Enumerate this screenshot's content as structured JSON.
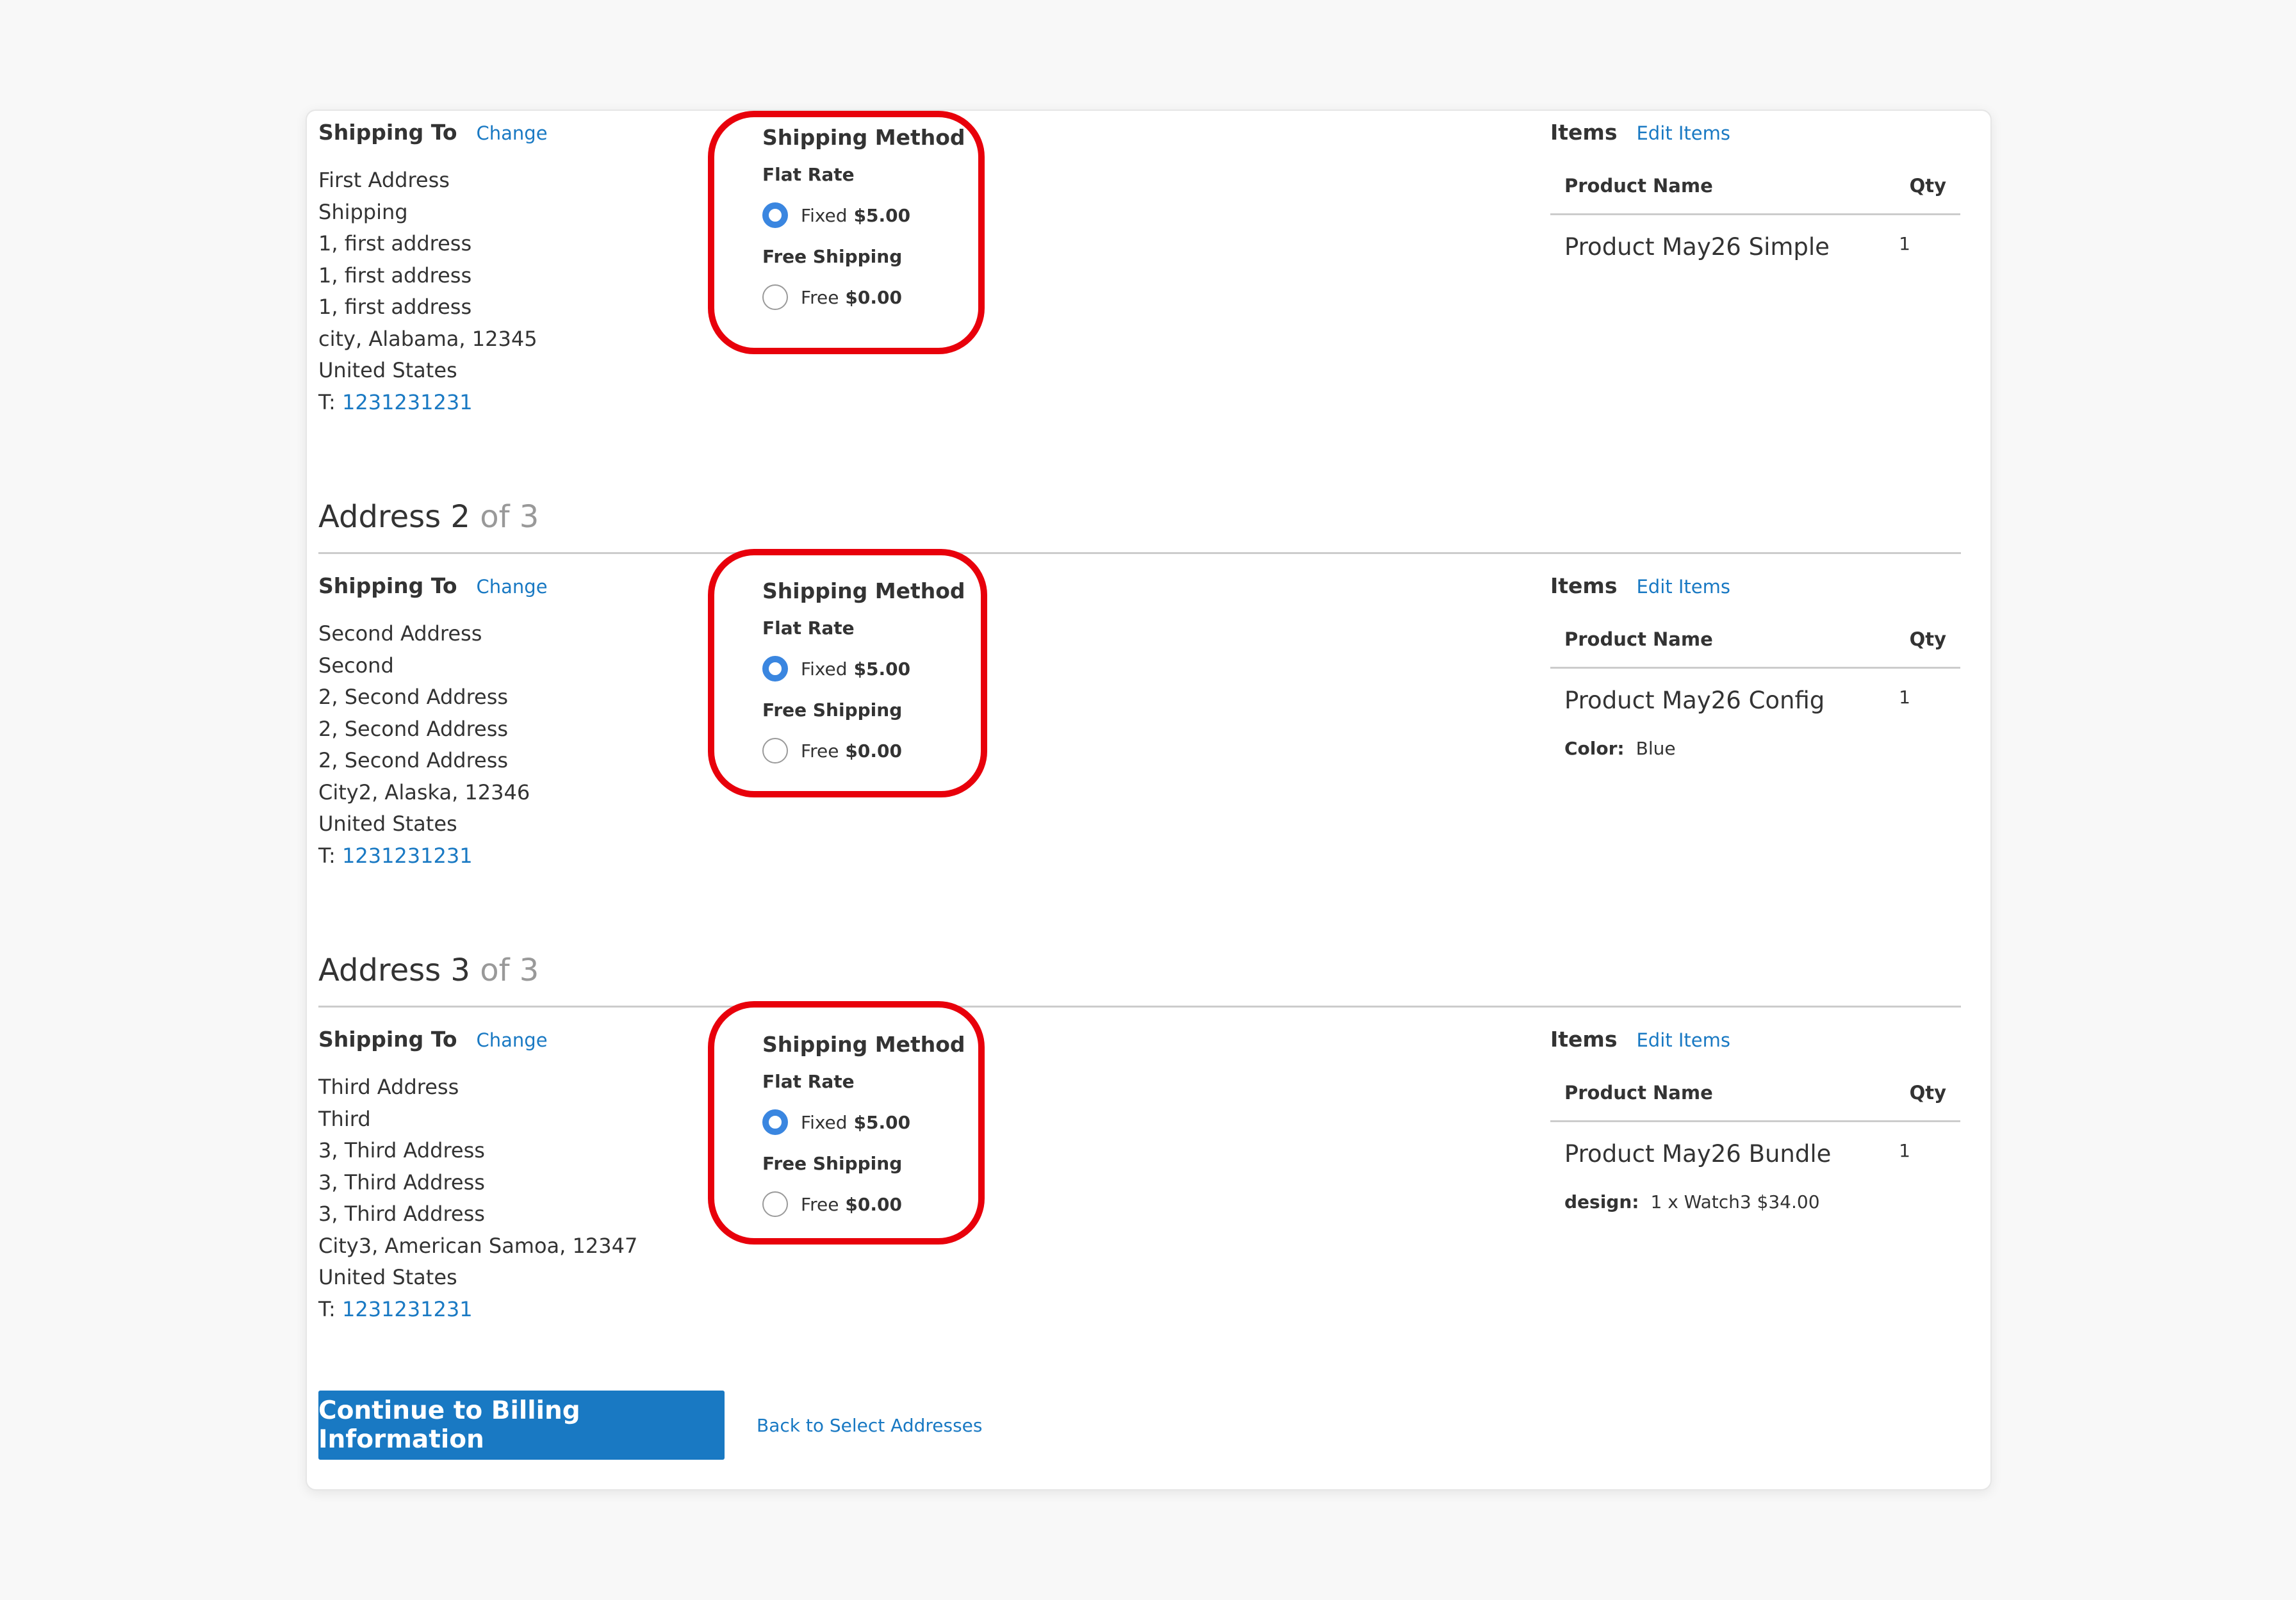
{
  "labels": {
    "shipping_to": "Shipping To",
    "change": "Change",
    "shipping_method": "Shipping Method",
    "items": "Items",
    "edit_items": "Edit Items",
    "product_name": "Product Name",
    "qty": "Qty",
    "address_word": "Address",
    "phone_prefix": "T:"
  },
  "sections": [
    {
      "address_number": "",
      "address_of": "",
      "address_lines": [
        "First Address",
        "Shipping",
        "1, first address",
        "1, first address",
        "1, first address",
        "city, Alabama, 12345",
        "United States"
      ],
      "phone": "1231231231",
      "methods": [
        {
          "carrier": "Flat Rate",
          "label": "Fixed",
          "price": "$5.00",
          "selected": true
        },
        {
          "carrier": "Free Shipping",
          "label": "Free",
          "price": "$0.00",
          "selected": false
        }
      ],
      "item": {
        "name": "Product May26 Simple",
        "qty": "1",
        "option_label": "",
        "option_value": ""
      }
    },
    {
      "address_number": "2",
      "address_of": "of 3",
      "address_lines": [
        "Second Address",
        "Second",
        "2, Second Address",
        "2, Second Address",
        "2, Second Address",
        "City2, Alaska, 12346",
        "United States"
      ],
      "phone": "1231231231",
      "methods": [
        {
          "carrier": "Flat Rate",
          "label": "Fixed",
          "price": "$5.00",
          "selected": true
        },
        {
          "carrier": "Free Shipping",
          "label": "Free",
          "price": "$0.00",
          "selected": false
        }
      ],
      "item": {
        "name": "Product May26 Config",
        "qty": "1",
        "option_label": "Color:",
        "option_value": "Blue"
      }
    },
    {
      "address_number": "3",
      "address_of": "of 3",
      "address_lines": [
        "Third Address",
        "Third",
        "3, Third Address",
        "3, Third Address",
        "3, Third Address",
        "City3, American Samoa, 12347",
        "United States"
      ],
      "phone": "1231231231",
      "methods": [
        {
          "carrier": "Flat Rate",
          "label": "Fixed",
          "price": "$5.00",
          "selected": true
        },
        {
          "carrier": "Free Shipping",
          "label": "Free",
          "price": "$0.00",
          "selected": false
        }
      ],
      "item": {
        "name": "Product May26 Bundle",
        "qty": "1",
        "option_label": "design:",
        "option_value": "1 x Watch3 $34.00"
      }
    }
  ],
  "actions": {
    "continue_label": "Continue to Billing Information",
    "back_label": "Back to Select Addresses"
  },
  "colors": {
    "link": "#1979c3",
    "primary_button": "#1979c3",
    "highlight": "#e8000b",
    "radio_checked": "#3a86e0"
  }
}
